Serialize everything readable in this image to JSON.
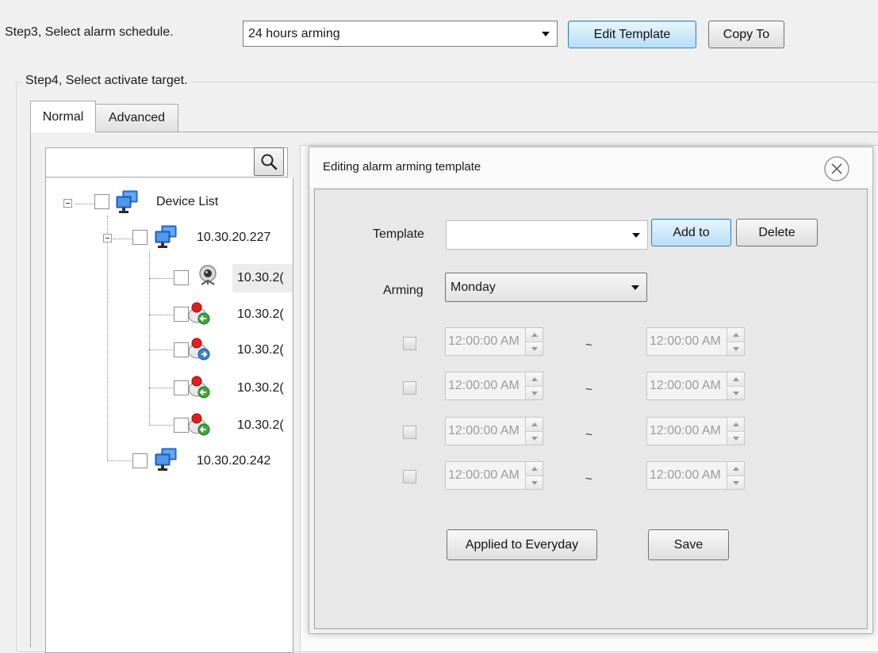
{
  "step3": {
    "label": "Step3, Select alarm schedule.",
    "schedule_value": "24 hours arming",
    "edit_template_label": "Edit Template",
    "copy_to_label": "Copy To"
  },
  "step4": {
    "label": "Step4, Select activate target.",
    "tabs": [
      {
        "label": "Normal",
        "active": true
      },
      {
        "label": "Advanced",
        "active": false
      }
    ]
  },
  "search": {
    "value": "",
    "icon": "search-icon"
  },
  "tree": {
    "root": {
      "label": "Device List",
      "icon": "monitor-group-icon"
    },
    "groups": [
      {
        "label": "10.30.20.227",
        "icon": "monitor-group-icon",
        "children": [
          {
            "label": "10.30.2(",
            "icon": "webcam-icon"
          },
          {
            "label": "10.30.2(",
            "icon": "alarm-input-icon"
          },
          {
            "label": "10.30.2(",
            "icon": "alarm-output-icon"
          },
          {
            "label": "10.30.2(",
            "icon": "alarm-input-icon"
          },
          {
            "label": "10.30.2(",
            "icon": "alarm-input-icon"
          }
        ]
      },
      {
        "label": "10.30.20.242",
        "icon": "monitor-group-icon",
        "children": []
      }
    ]
  },
  "dialog": {
    "title": "Editing alarm arming template",
    "close_icon": "close-icon",
    "template_label": "Template",
    "template_value": "",
    "add_to_label": "Add to",
    "delete_label": "Delete",
    "arming_label": "Arming",
    "arming_value": "Monday",
    "tilde": "~",
    "periods": [
      {
        "checked": false,
        "start": "12:00:00 AM",
        "end": "12:00:00 AM"
      },
      {
        "checked": false,
        "start": "12:00:00 AM",
        "end": "12:00:00 AM"
      },
      {
        "checked": false,
        "start": "12:00:00 AM",
        "end": "12:00:00 AM"
      },
      {
        "checked": false,
        "start": "12:00:00 AM",
        "end": "12:00:00 AM"
      }
    ],
    "apply_everyday_label": "Applied to Everyday",
    "save_label": "Save"
  },
  "colors": {
    "focus_button": "#b8ddf6",
    "window_bg": "#f0f0f0",
    "monitor_blue": "#1e64c8"
  }
}
